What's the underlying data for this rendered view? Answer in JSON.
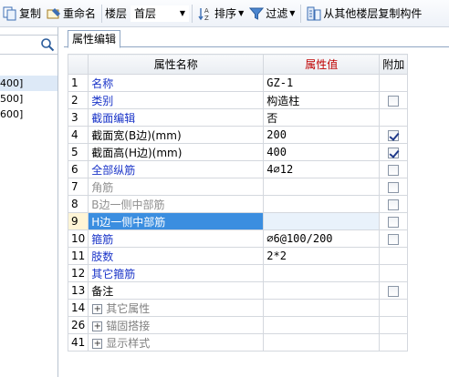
{
  "toolbar": {
    "copy_label": "复制",
    "rename_label": "重命名",
    "floor_label": "楼层",
    "floor_value": "首层",
    "sort_label": "排序",
    "filter_label": "过滤",
    "copy_from_floor_label": "从其他楼层复制构件"
  },
  "left": {
    "items": [
      "400]",
      "500]",
      "600]"
    ],
    "search_icon": "search-icon"
  },
  "panel": {
    "tab_label": "属性编辑",
    "headers": {
      "name": "属性名称",
      "value": "属性值",
      "extra": "附加"
    },
    "rows": [
      {
        "num": "1",
        "name": "名称",
        "value": "GZ-1",
        "check": "none",
        "style": "blue"
      },
      {
        "num": "2",
        "name": "类别",
        "value": "构造柱",
        "check": "empty",
        "style": "blue"
      },
      {
        "num": "3",
        "name": "截面编辑",
        "value": "否",
        "check": "none",
        "style": "blue"
      },
      {
        "num": "4",
        "name": "截面宽(B边)(mm)",
        "value": "200",
        "check": "checked",
        "style": "black"
      },
      {
        "num": "5",
        "name": "截面高(H边)(mm)",
        "value": "400",
        "check": "checked",
        "style": "black"
      },
      {
        "num": "6",
        "name": "全部纵筋",
        "value": "4⌀12",
        "check": "empty",
        "style": "blue"
      },
      {
        "num": "7",
        "name": "角筋",
        "value": "",
        "check": "empty",
        "style": "gray"
      },
      {
        "num": "8",
        "name": "B边一侧中部筋",
        "value": "",
        "check": "empty",
        "style": "gray"
      },
      {
        "num": "9",
        "name": "H边一侧中部筋",
        "value": "",
        "check": "empty",
        "style": "gray",
        "selected": true
      },
      {
        "num": "10",
        "name": "箍筋",
        "value": "⌀6@100/200",
        "check": "empty",
        "style": "blue"
      },
      {
        "num": "11",
        "name": "肢数",
        "value": "2*2",
        "check": "none",
        "style": "blue"
      },
      {
        "num": "12",
        "name": "其它箍筋",
        "value": "",
        "check": "none",
        "style": "blue"
      },
      {
        "num": "13",
        "name": "备注",
        "value": "",
        "check": "empty",
        "style": "black"
      },
      {
        "num": "14",
        "name": "其它属性",
        "value": "",
        "check": "none",
        "style": "group",
        "expander": "+"
      },
      {
        "num": "26",
        "name": "锚固搭接",
        "value": "",
        "check": "none",
        "style": "group",
        "expander": "+"
      },
      {
        "num": "41",
        "name": "显示样式",
        "value": "",
        "check": "none",
        "style": "group",
        "expander": "+"
      }
    ]
  }
}
